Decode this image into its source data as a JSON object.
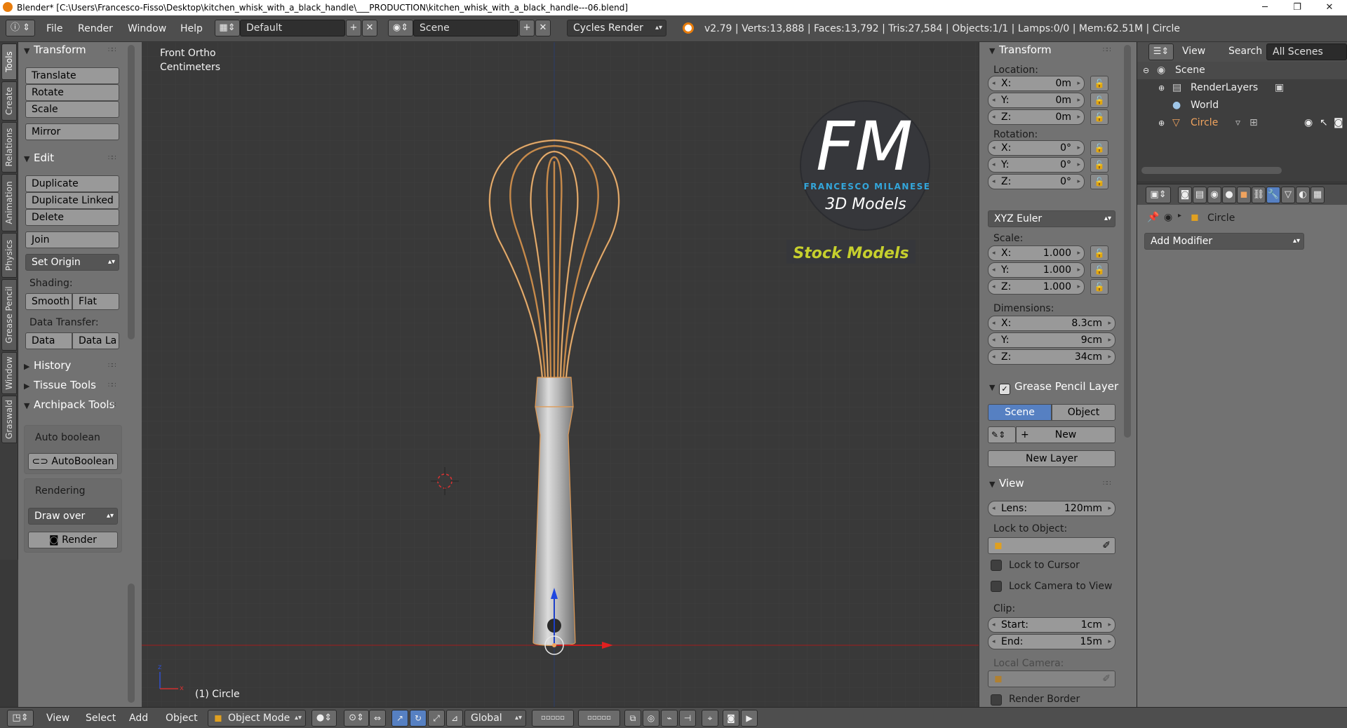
{
  "titlebar": {
    "title": "Blender* [C:\\Users\\Francesco-Fisso\\Desktop\\kitchen_whisk_with_a_black_handle\\___PRODUCTION\\kitchen_whisk_with_a_black_handle---06.blend]",
    "minimize": "─",
    "maximize": "❐",
    "close": "✕"
  },
  "topbar": {
    "editor_icon": "ⓘ",
    "menus": [
      "File",
      "Render",
      "Window",
      "Help"
    ],
    "layout": "Default",
    "scene": "Scene",
    "engine": "Cycles Render",
    "stats": "v2.79 | Verts:13,888 | Faces:13,792 | Tris:27,584 | Objects:1/1 | Lamps:0/0 | Mem:62.51M | Circle"
  },
  "tabs": [
    "Tools",
    "Create",
    "Relations",
    "Animation",
    "Physics",
    "Grease Pencil",
    "Window",
    "Graswald"
  ],
  "toolshelf": {
    "transform": {
      "title": "Transform",
      "buttons": [
        "Translate",
        "Rotate",
        "Scale",
        "Mirror"
      ]
    },
    "edit": {
      "title": "Edit",
      "buttons": [
        "Duplicate",
        "Duplicate Linked",
        "Delete",
        "Join",
        "Set Origin"
      ]
    },
    "shading_label": "Shading:",
    "shading": [
      "Smooth",
      "Flat"
    ],
    "data_transfer_label": "Data Transfer:",
    "data_transfer": [
      "Data",
      "Data La"
    ],
    "history": "History",
    "tissue": "Tissue Tools",
    "archipack": "Archipack Tools",
    "auto_boolean_label": "Auto boolean",
    "auto_boolean_btn": "AutoBoolean",
    "rendering_label": "Rendering",
    "draw_over": "Draw over",
    "render_btn": "Render"
  },
  "viewport": {
    "view_name": "Front Ortho",
    "units": "Centimeters",
    "object_label": "(1) Circle",
    "logo": {
      "letters": "FM",
      "name": "FRANCESCO MILANESE",
      "sub": "3D Models",
      "stock": "Stock Models"
    }
  },
  "props": {
    "transform_title": "Transform",
    "location_label": "Location:",
    "location": [
      {
        "k": "X:",
        "v": "0m"
      },
      {
        "k": "Y:",
        "v": "0m"
      },
      {
        "k": "Z:",
        "v": "0m"
      }
    ],
    "rotation_label": "Rotation:",
    "rotation": [
      {
        "k": "X:",
        "v": "0°"
      },
      {
        "k": "Y:",
        "v": "0°"
      },
      {
        "k": "Z:",
        "v": "0°"
      }
    ],
    "rotation_mode": "XYZ Euler",
    "scale_label": "Scale:",
    "scale": [
      {
        "k": "X:",
        "v": "1.000"
      },
      {
        "k": "Y:",
        "v": "1.000"
      },
      {
        "k": "Z:",
        "v": "1.000"
      }
    ],
    "dimensions_label": "Dimensions:",
    "dimensions": [
      {
        "k": "X:",
        "v": "8.3cm"
      },
      {
        "k": "Y:",
        "v": "9cm"
      },
      {
        "k": "Z:",
        "v": "34cm"
      }
    ],
    "gp_title": "Grease Pencil Layer",
    "gp_scene": "Scene",
    "gp_object": "Object",
    "gp_new": "New",
    "gp_new_layer": "New Layer",
    "view_title": "View",
    "lens_k": "Lens:",
    "lens_v": "120mm",
    "lock_to_object": "Lock to Object:",
    "lock_to_cursor": "Lock to Cursor",
    "lock_camera": "Lock Camera to View",
    "clip_label": "Clip:",
    "clip_start_k": "Start:",
    "clip_start_v": "1cm",
    "clip_end_k": "End:",
    "clip_end_v": "15m",
    "local_camera": "Local Camera:",
    "render_border": "Render Border"
  },
  "outliner": {
    "header": {
      "view": "View",
      "search": "Search",
      "filter": "All Scenes"
    },
    "rows": [
      {
        "label": "Scene"
      },
      {
        "label": "RenderLayers"
      },
      {
        "label": "World"
      },
      {
        "label": "Circle"
      }
    ]
  },
  "propeditor": {
    "object_name": "Circle",
    "add_modifier": "Add Modifier"
  },
  "bottombar": {
    "menus": [
      "View",
      "Select",
      "Add",
      "Object"
    ],
    "mode": "Object Mode",
    "orientation": "Global"
  },
  "colors": {
    "accent_blue": "#5680c2",
    "selection_orange": "#f0a35e",
    "logo_blue": "#33a6db",
    "logo_yellow": "#c6cf2d"
  }
}
